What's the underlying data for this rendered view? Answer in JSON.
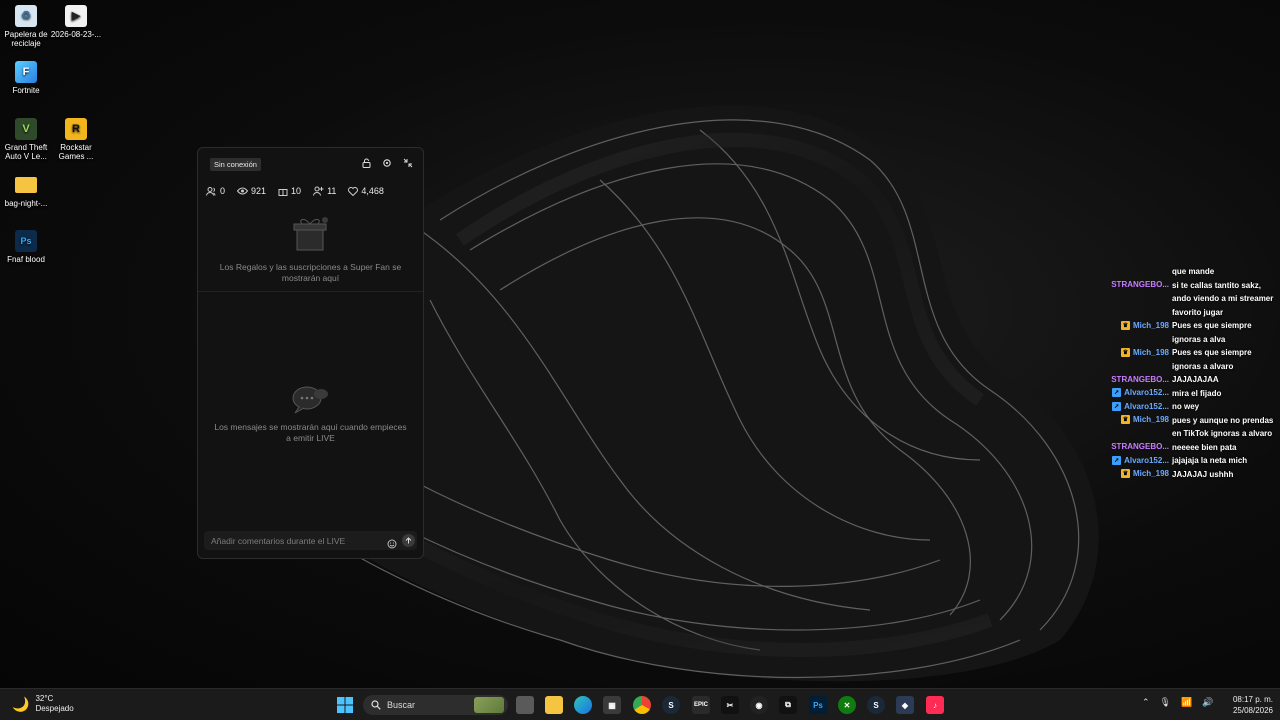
{
  "desktop": {
    "icons": [
      {
        "label": "Papelera de reciclaje",
        "icon": "recycle-bin-icon"
      },
      {
        "label": "2026-08-23-...",
        "icon": "video-file-icon"
      },
      {
        "label": "Fortnite",
        "icon": "fortnite-icon"
      },
      {
        "label": "Grand Theft Auto V Le...",
        "icon": "gta-v-icon"
      },
      {
        "label": "Rockstar Games ...",
        "icon": "rockstar-icon"
      },
      {
        "label": "bag-night-...",
        "icon": "folder-icon"
      },
      {
        "label": "Fnaf blood",
        "icon": "photoshop-file-icon"
      }
    ]
  },
  "panel": {
    "status_badge": "Sin conexión",
    "stats": {
      "members": "0",
      "viewers": "921",
      "gifts": "10",
      "followers": "11",
      "likes": "4,468"
    },
    "gifts_empty_text": "Los Regalos y las suscripciones a Super Fan se mostrarán aquí",
    "messages_empty_text": "Los mensajes se mostrarán aquí cuando empieces a emitir LIVE",
    "comment_placeholder": "Añadir comentarios durante el LIVE"
  },
  "chat": {
    "colors": {
      "purple": "#c77dff",
      "blue": "#6aaaff",
      "mod_badge": "#f0b429",
      "sub_badge": "#3aa0ff"
    },
    "messages": [
      {
        "user": "",
        "text": "que mande",
        "color": "",
        "badge": ""
      },
      {
        "user": "STRANGEBO...",
        "text": "si te callas tantito sakz, ando viendo a mi streamer favorito jugar",
        "color": "#c77dff",
        "badge": ""
      },
      {
        "user": "Mich_198",
        "text": "Pues es que siempre ignoras a alva",
        "color": "#6aaaff",
        "badge": "mod"
      },
      {
        "user": "Mich_198",
        "text": "Pues es que siempre ignoras a alvaro",
        "color": "#6aaaff",
        "badge": "mod"
      },
      {
        "user": "STRANGEBO...",
        "text": "JAJAJAJAA",
        "color": "#c77dff",
        "badge": ""
      },
      {
        "user": "Alvaro152...",
        "text": "mira el fijado",
        "color": "#6aaaff",
        "badge": "sub"
      },
      {
        "user": "Alvaro152...",
        "text": "no wey",
        "color": "#6aaaff",
        "badge": "sub"
      },
      {
        "user": "Mich_198",
        "text": "pues y aunque no prendas en TikTok ignoras a alvaro",
        "color": "#6aaaff",
        "badge": "mod"
      },
      {
        "user": "STRANGEBO...",
        "text": "neeeee bien pata",
        "color": "#c77dff",
        "badge": ""
      },
      {
        "user": "Alvaro152...",
        "text": "jajajaja la neta mich",
        "color": "#6aaaff",
        "badge": "sub"
      },
      {
        "user": "Mich_198",
        "text": "JAJAJAJ ushhh",
        "color": "#6aaaff",
        "badge": "mod"
      }
    ]
  },
  "taskbar": {
    "weather_temp": "32°C",
    "weather_desc": "Despejado",
    "search_label": "Buscar",
    "time": "08:17 p. m.",
    "date": "25/08/2026",
    "app_icons": [
      "windows-start-icon",
      "file-explorer-icon",
      "edge-icon",
      "microsoft-store-icon",
      "chrome-icon",
      "steam-icon",
      "epic-games-icon",
      "capcut-icon",
      "obs-icon",
      "capcut-alt-icon",
      "photoshop-icon",
      "xbox-icon",
      "steam-alt-icon",
      "streamlabs-icon",
      "tiktok-live-icon"
    ]
  }
}
